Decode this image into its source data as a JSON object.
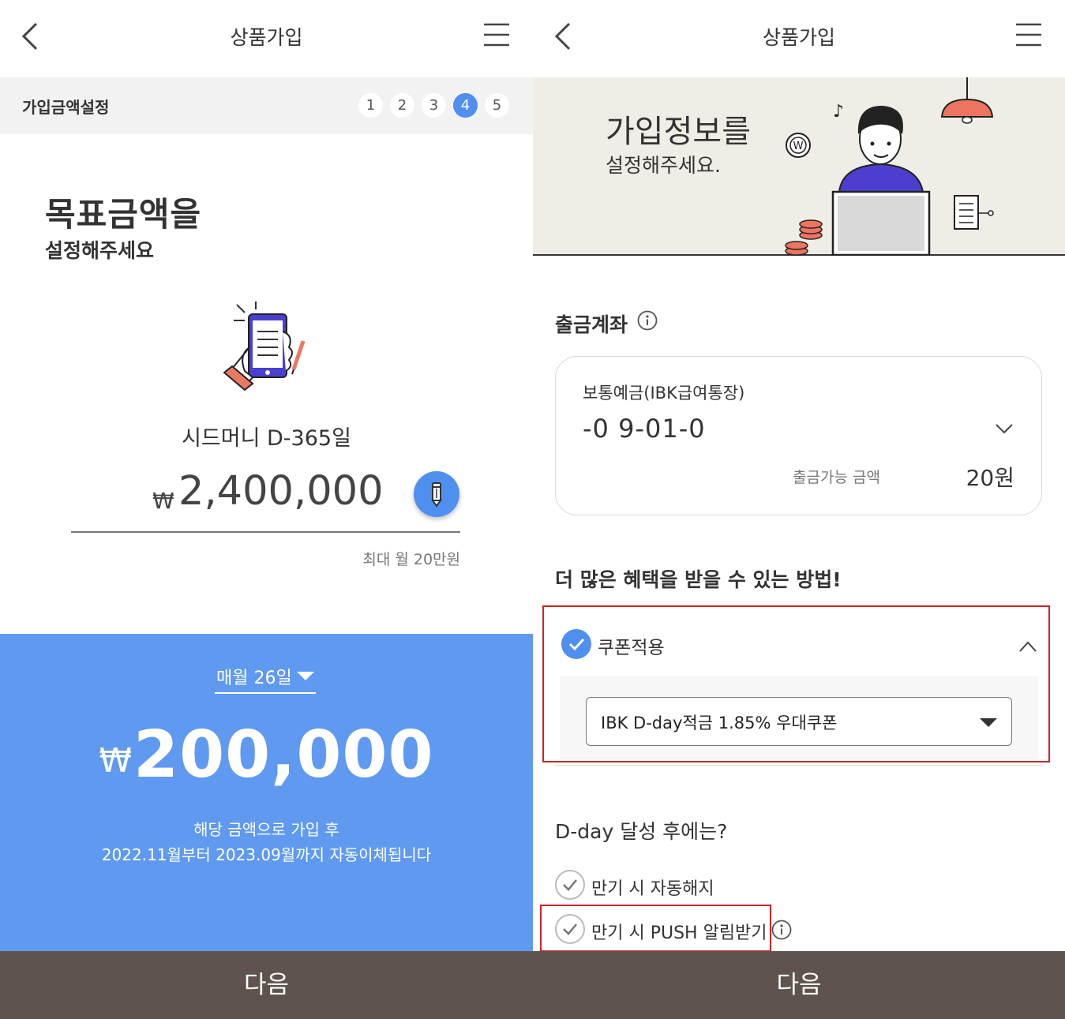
{
  "left": {
    "header": {
      "title": "상품가입"
    },
    "stepbar": {
      "label": "가입금액설정",
      "steps": [
        "1",
        "2",
        "3",
        "4",
        "5"
      ],
      "active_step": "4"
    },
    "heading": {
      "title": "목표금액을",
      "subtitle": "설정해주세요"
    },
    "dday_label": "시드머니 D-365일",
    "amount": {
      "currency": "₩",
      "value": "2,400,000"
    },
    "max_note": "최대 월 20만원",
    "monthly": {
      "date_select": "매월 26일",
      "currency": "₩",
      "value": "200,000",
      "note_line1": "해당 금액으로 가입 후",
      "note_line2": "2022.11월부터 2023.09월까지 자동이체됩니다"
    },
    "next_button": "다음"
  },
  "right": {
    "header": {
      "title": "상품가입"
    },
    "banner": {
      "title": "가입정보를",
      "subtitle": "설정해주세요."
    },
    "withdraw": {
      "title": "출금계좌",
      "account_name": "보통예금(IBK급여통장)",
      "account_number": "-0    9-01-0",
      "available_label": "출금가능 금액",
      "available_value": "20원"
    },
    "benefit": {
      "title": "더 많은 혜택을 받을 수 있는 방법!",
      "coupon_label": "쿠폰적용",
      "coupon_selected": "IBK D-day적금 1.85% 우대쿠폰"
    },
    "dday": {
      "title": "D-day 달성 후에는?",
      "options": [
        "만기 시 자동해지",
        "만기 시 PUSH 알림받기"
      ]
    },
    "next_button": "다음"
  },
  "colors": {
    "accent_blue": "#4f8ff0",
    "panel_blue": "#5f9af0",
    "footer_brown": "#5e544d",
    "highlight_red": "#d0222a"
  }
}
